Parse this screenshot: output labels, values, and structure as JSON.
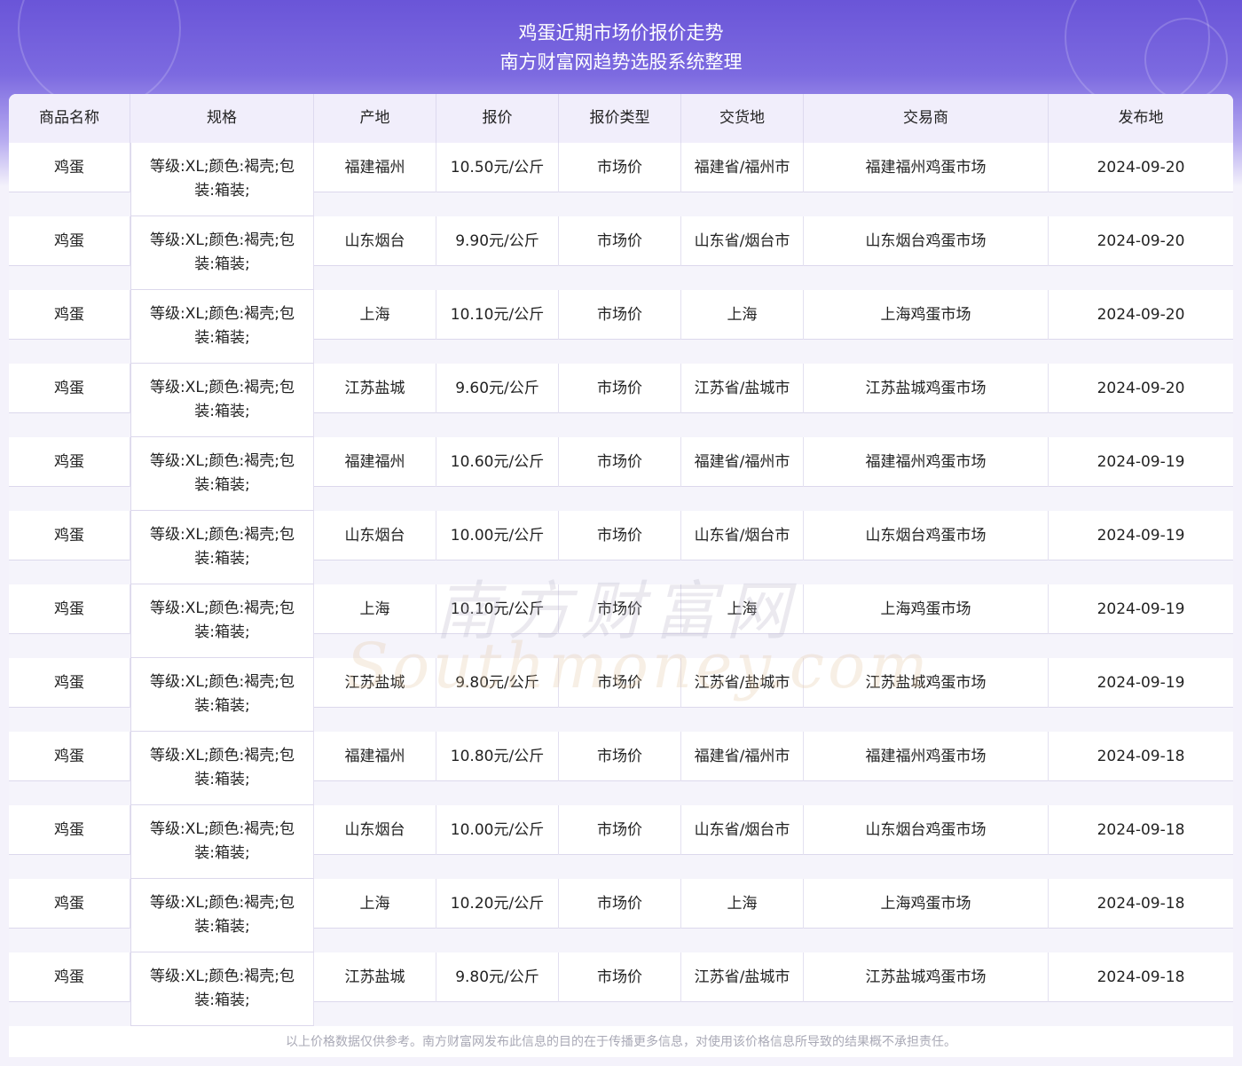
{
  "header": {
    "title_line1": "鸡蛋近期市场价报价走势",
    "title_line2": "南方财富网趋势选股系统整理"
  },
  "table": {
    "columns": [
      "商品名称",
      "规格",
      "产地",
      "报价",
      "报价类型",
      "交货地",
      "交易商",
      "发布地"
    ],
    "rows": [
      [
        "鸡蛋",
        "等级:XL;颜色:褐壳;包装:箱装;",
        "福建福州",
        "10.50元/公斤",
        "市场价",
        "福建省/福州市",
        "福建福州鸡蛋市场",
        "2024-09-20"
      ],
      [
        "鸡蛋",
        "等级:XL;颜色:褐壳;包装:箱装;",
        "山东烟台",
        "9.90元/公斤",
        "市场价",
        "山东省/烟台市",
        "山东烟台鸡蛋市场",
        "2024-09-20"
      ],
      [
        "鸡蛋",
        "等级:XL;颜色:褐壳;包装:箱装;",
        "上海",
        "10.10元/公斤",
        "市场价",
        "上海",
        "上海鸡蛋市场",
        "2024-09-20"
      ],
      [
        "鸡蛋",
        "等级:XL;颜色:褐壳;包装:箱装;",
        "江苏盐城",
        "9.60元/公斤",
        "市场价",
        "江苏省/盐城市",
        "江苏盐城鸡蛋市场",
        "2024-09-20"
      ],
      [
        "鸡蛋",
        "等级:XL;颜色:褐壳;包装:箱装;",
        "福建福州",
        "10.60元/公斤",
        "市场价",
        "福建省/福州市",
        "福建福州鸡蛋市场",
        "2024-09-19"
      ],
      [
        "鸡蛋",
        "等级:XL;颜色:褐壳;包装:箱装;",
        "山东烟台",
        "10.00元/公斤",
        "市场价",
        "山东省/烟台市",
        "山东烟台鸡蛋市场",
        "2024-09-19"
      ],
      [
        "鸡蛋",
        "等级:XL;颜色:褐壳;包装:箱装;",
        "上海",
        "10.10元/公斤",
        "市场价",
        "上海",
        "上海鸡蛋市场",
        "2024-09-19"
      ],
      [
        "鸡蛋",
        "等级:XL;颜色:褐壳;包装:箱装;",
        "江苏盐城",
        "9.80元/公斤",
        "市场价",
        "江苏省/盐城市",
        "江苏盐城鸡蛋市场",
        "2024-09-19"
      ],
      [
        "鸡蛋",
        "等级:XL;颜色:褐壳;包装:箱装;",
        "福建福州",
        "10.80元/公斤",
        "市场价",
        "福建省/福州市",
        "福建福州鸡蛋市场",
        "2024-09-18"
      ],
      [
        "鸡蛋",
        "等级:XL;颜色:褐壳;包装:箱装;",
        "山东烟台",
        "10.00元/公斤",
        "市场价",
        "山东省/烟台市",
        "山东烟台鸡蛋市场",
        "2024-09-18"
      ],
      [
        "鸡蛋",
        "等级:XL;颜色:褐壳;包装:箱装;",
        "上海",
        "10.20元/公斤",
        "市场价",
        "上海",
        "上海鸡蛋市场",
        "2024-09-18"
      ],
      [
        "鸡蛋",
        "等级:XL;颜色:褐壳;包装:箱装;",
        "江苏盐城",
        "9.80元/公斤",
        "市场价",
        "江苏省/盐城市",
        "江苏盐城鸡蛋市场",
        "2024-09-18"
      ]
    ]
  },
  "watermark": {
    "cn": "南方财富网",
    "en": "Southmoney.com"
  },
  "footer": {
    "disclaimer": "以上价格数据仅供参考。南方财富网发布此信息的目的在于传播更多信息，对使用该价格信息所导致的结果概不承担责任。"
  },
  "colors": {
    "header_top": "#6a55d8",
    "table_header_bg": "#f1eefb",
    "gap_bg": "#f5f4fb"
  }
}
